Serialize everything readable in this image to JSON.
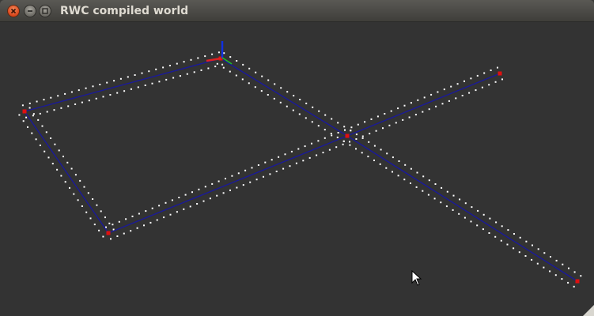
{
  "window": {
    "title": "RWC compiled world",
    "buttons": [
      {
        "name": "close-button",
        "icon": "close-icon"
      },
      {
        "name": "minimize-button",
        "icon": "minimize-icon"
      },
      {
        "name": "maximize-button",
        "icon": "maximize-icon"
      }
    ]
  },
  "scene": {
    "background": "#333333",
    "road_color": "#1a1a9a",
    "node_color": "#e01010",
    "marker_color": "#ffffff",
    "axis_colors": {
      "x": "#e02020",
      "y": "#20c020",
      "z": "#1030e0"
    }
  },
  "cursor": {
    "icon": "mouse-pointer-icon"
  }
}
